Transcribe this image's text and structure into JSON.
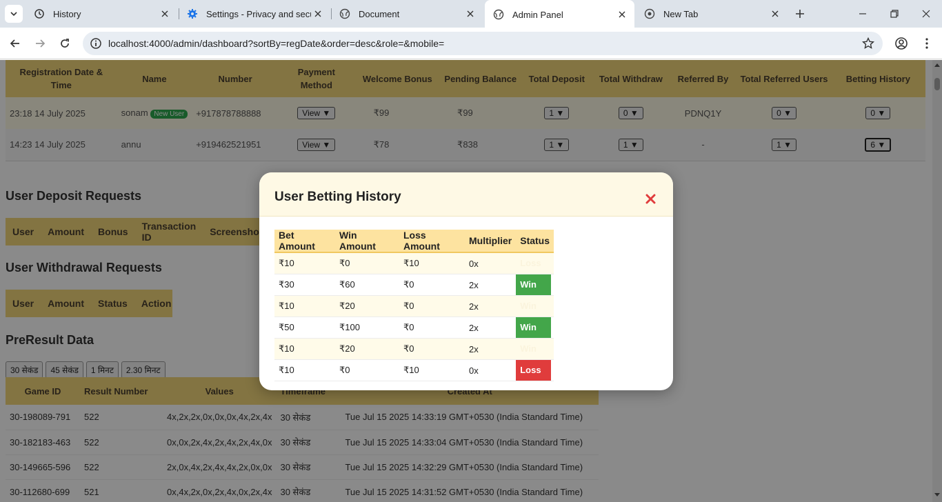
{
  "browser": {
    "tabs": [
      {
        "title": "History",
        "icon": "history-icon",
        "active": false
      },
      {
        "title": "Settings - Privacy and security",
        "icon": "gear-icon",
        "active": false
      },
      {
        "title": "Document",
        "icon": "globe-icon",
        "active": false
      },
      {
        "title": "Admin Panel",
        "icon": "globe-icon",
        "active": true
      },
      {
        "title": "New Tab",
        "icon": "chrome-icon",
        "active": false
      }
    ],
    "url": "localhost:4000/admin/dashboard?sortBy=regDate&order=desc&role=&mobile="
  },
  "users_table": {
    "headers": [
      "Registration Date & Time",
      "Name",
      "Number",
      "Payment Method",
      "Welcome Bonus",
      "Pending Balance",
      "Total Deposit",
      "Total Withdraw",
      "Referred By",
      "Total Referred Users",
      "Betting History"
    ],
    "rows": [
      {
        "date": "23:18 14 July 2025",
        "name": "sonam",
        "badge": "New User",
        "number": "+917878788888",
        "payment": "View ▼",
        "bonus": "₹99",
        "pending": "₹99",
        "deposit": "1 ▼",
        "withdraw": "0 ▼",
        "referred_by": "PDNQ1Y",
        "referred_users": "0 ▼",
        "betting": "0 ▼"
      },
      {
        "date": "14:23 14 July 2025",
        "name": "annu",
        "badge": "",
        "number": "+919462521951",
        "payment": "View ▼",
        "bonus": "₹78",
        "pending": "₹838",
        "deposit": "1 ▼",
        "withdraw": "1 ▼",
        "referred_by": "-",
        "referred_users": "1 ▼",
        "betting": "6 ▼"
      }
    ]
  },
  "deposit_section": {
    "title": "User Deposit Requests",
    "headers": [
      "User",
      "Amount",
      "Bonus",
      "Transaction ID",
      "Screenshot"
    ]
  },
  "withdrawal_section": {
    "title": "User Withdrawal Requests",
    "headers": [
      "User",
      "Amount",
      "Status",
      "Action"
    ]
  },
  "preresult_section": {
    "title": "PreResult Data",
    "filters": [
      "30 सेकंड",
      "45 सेकंड",
      "1 मिनट",
      "2.30 मिनट"
    ],
    "headers": [
      "Game ID",
      "Result Number",
      "Values",
      "Timeframe",
      "Created At"
    ],
    "rows": [
      {
        "game_id": "30-198089-791",
        "result": "522",
        "values": "4x,2x,2x,0x,0x,0x,4x,2x,4x",
        "timeframe": "30 सेकंड",
        "created": "Tue Jul 15 2025 14:33:19 GMT+0530 (India Standard Time)"
      },
      {
        "game_id": "30-182183-463",
        "result": "522",
        "values": "0x,0x,2x,4x,2x,4x,2x,4x,0x",
        "timeframe": "30 सेकंड",
        "created": "Tue Jul 15 2025 14:33:04 GMT+0530 (India Standard Time)"
      },
      {
        "game_id": "30-149665-596",
        "result": "522",
        "values": "2x,0x,4x,2x,4x,4x,2x,0x,0x",
        "timeframe": "30 सेकंड",
        "created": "Tue Jul 15 2025 14:32:29 GMT+0530 (India Standard Time)"
      },
      {
        "game_id": "30-112680-699",
        "result": "521",
        "values": "0x,4x,2x,0x,2x,4x,0x,2x,4x",
        "timeframe": "30 सेकंड",
        "created": "Tue Jul 15 2025 14:31:52 GMT+0530 (India Standard Time)"
      }
    ]
  },
  "modal": {
    "title": "User Betting History",
    "headers": [
      "Bet Amount",
      "Win Amount",
      "Loss Amount",
      "Multiplier",
      "Status"
    ],
    "rows": [
      {
        "bet": "₹10",
        "win": "₹0",
        "loss": "₹10",
        "multiplier": "0x",
        "status": "Loss",
        "status_kind": "ghost"
      },
      {
        "bet": "₹30",
        "win": "₹60",
        "loss": "₹0",
        "multiplier": "2x",
        "status": "Win",
        "status_kind": "win"
      },
      {
        "bet": "₹10",
        "win": "₹20",
        "loss": "₹0",
        "multiplier": "2x",
        "status": "Win",
        "status_kind": "ghost"
      },
      {
        "bet": "₹50",
        "win": "₹100",
        "loss": "₹0",
        "multiplier": "2x",
        "status": "Win",
        "status_kind": "win"
      },
      {
        "bet": "₹10",
        "win": "₹20",
        "loss": "₹0",
        "multiplier": "2x",
        "status": "Win",
        "status_kind": "ghost"
      },
      {
        "bet": "₹10",
        "win": "₹0",
        "loss": "₹10",
        "multiplier": "0x",
        "status": "Loss",
        "status_kind": "loss"
      }
    ]
  },
  "colors": {
    "header_yellow": "#f3d67a",
    "win_green": "#43a64a",
    "loss_red": "#e03c3c",
    "close_red": "#e03c3c"
  }
}
